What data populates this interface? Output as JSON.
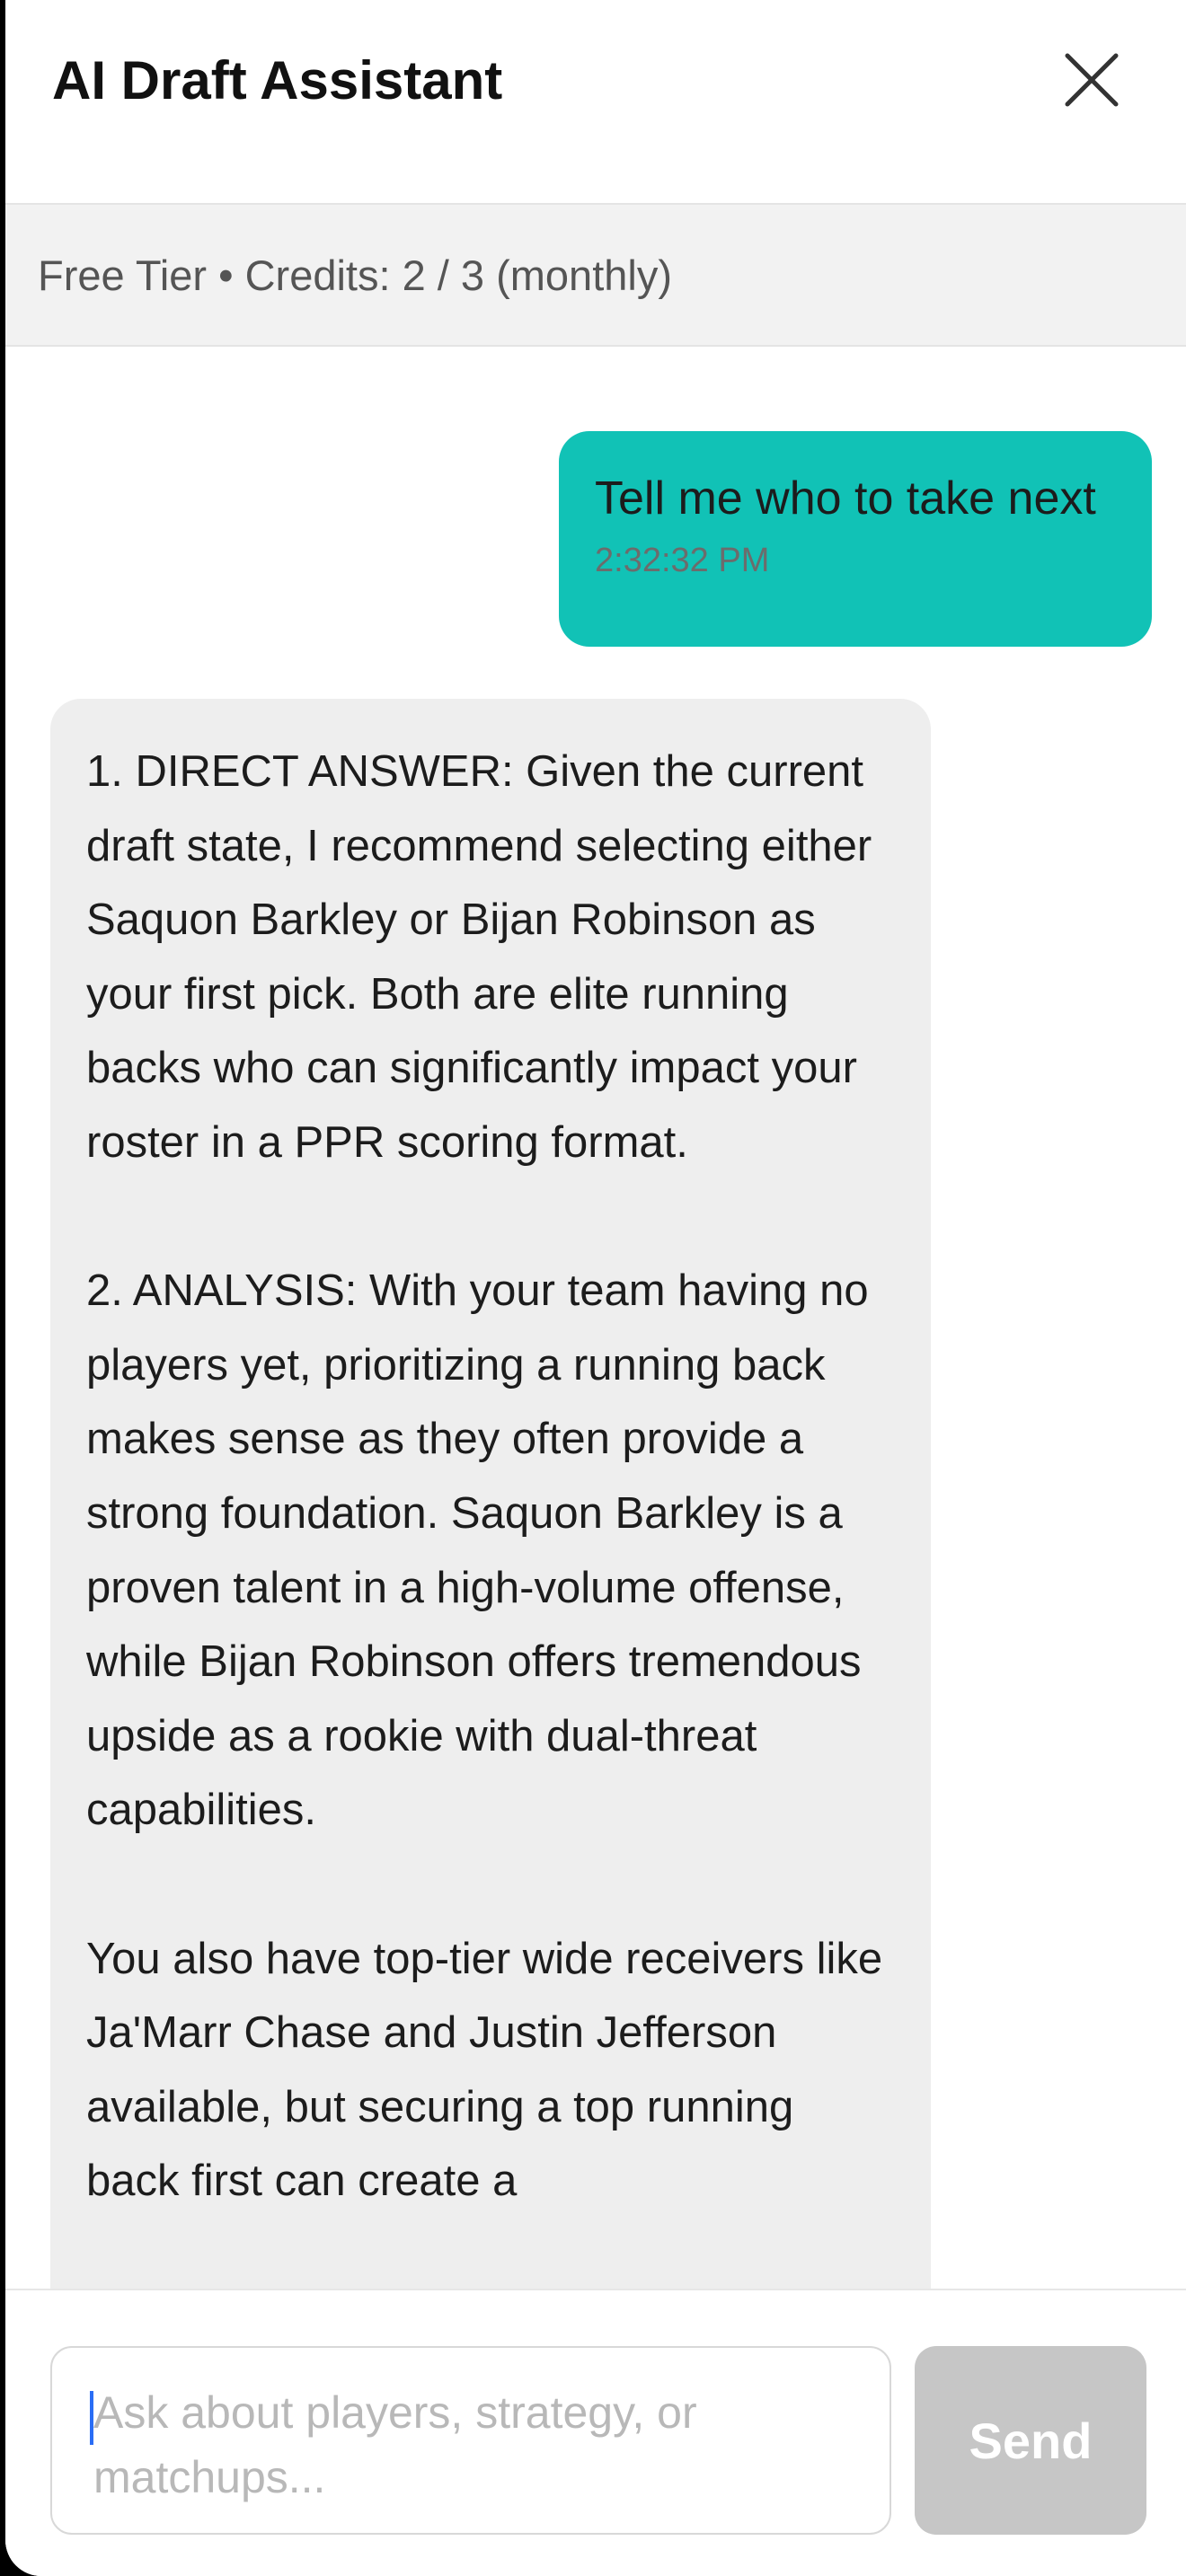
{
  "header": {
    "title": "AI Draft Assistant",
    "close_icon": "close-icon"
  },
  "tier_bar": {
    "text": "Free Tier • Credits: 2 / 3 (monthly)"
  },
  "messages": [
    {
      "role": "user",
      "text": "Tell me who to take next",
      "time": "2:32:32 PM"
    },
    {
      "role": "assistant",
      "paragraphs": [
        "1. DIRECT ANSWER: Given the current draft state, I recommend selecting either Saquon Barkley or Bijan Robinson as your first pick. Both are elite running backs who can significantly impact your roster in a PPR scoring format.",
        "2. ANALYSIS: With your team having no players yet, prioritizing a running back makes sense as they often provide a strong foundation. Saquon Barkley is a proven talent in a high-volume offense, while Bijan Robinson offers tremendous upside as a rookie with dual-threat capabilities.",
        "You also have top-tier wide receivers like Ja'Marr Chase and Justin Jefferson available, but securing a top running back first can create a"
      ]
    }
  ],
  "composer": {
    "placeholder": "Ask about players, strategy, or matchups...",
    "send_label": "Send"
  },
  "colors": {
    "user_bubble": "#11c2b6",
    "assistant_bubble": "#eeeeee",
    "send_disabled": "#c6c6c6",
    "tier_bar_bg": "#f2f2f2"
  }
}
